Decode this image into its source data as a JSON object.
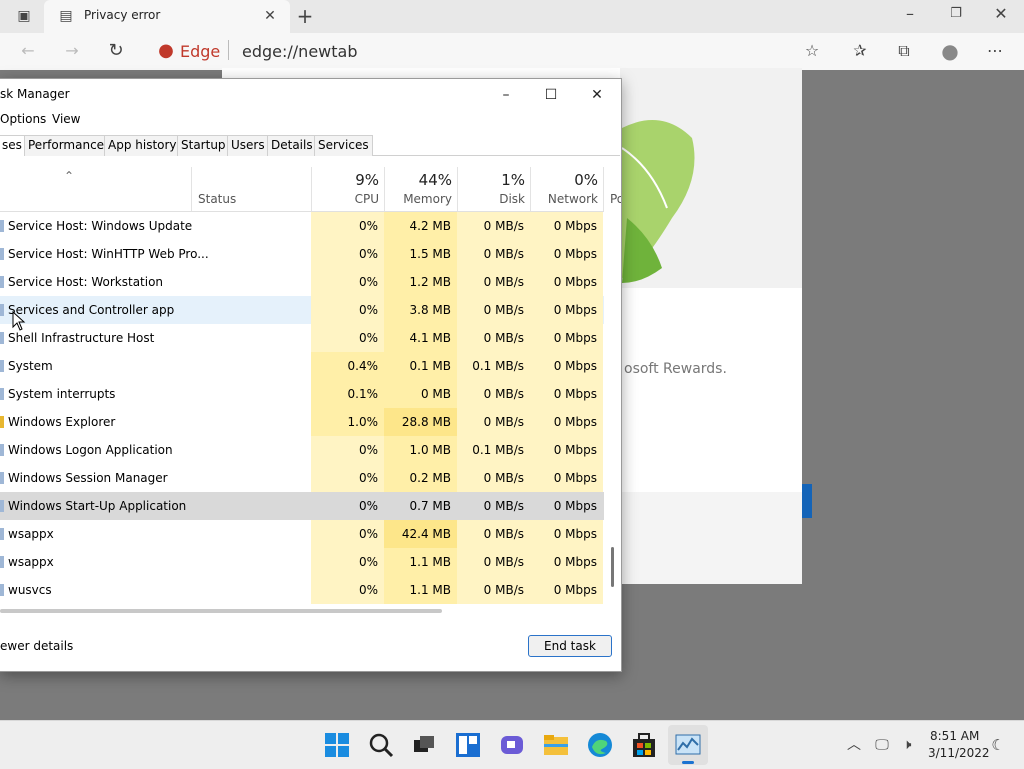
{
  "browser": {
    "tab_title": "Privacy error",
    "brand": "Edge",
    "url": "edge://newtab"
  },
  "page": {
    "rewards_text": "osoft Rewards."
  },
  "task_manager": {
    "title": "sk Manager",
    "menu": [
      "Options",
      "View"
    ],
    "tabs": [
      "ses",
      "Performance",
      "App history",
      "Startup",
      "Users",
      "Details",
      "Services"
    ],
    "columns": {
      "status": "Status",
      "cpu": {
        "pct": "9%",
        "label": "CPU"
      },
      "memory": {
        "pct": "44%",
        "label": "Memory"
      },
      "disk": {
        "pct": "1%",
        "label": "Disk"
      },
      "network": {
        "pct": "0%",
        "label": "Network"
      },
      "power_partial": "Po"
    },
    "rows": [
      {
        "name": "Service Host: Windows Update",
        "cpu": "0%",
        "mem": "4.2 MB",
        "disk": "0 MB/s",
        "net": "0 Mbps"
      },
      {
        "name": "Service Host: WinHTTP Web Pro...",
        "cpu": "0%",
        "mem": "1.5 MB",
        "disk": "0 MB/s",
        "net": "0 Mbps"
      },
      {
        "name": "Service Host: Workstation",
        "cpu": "0%",
        "mem": "1.2 MB",
        "disk": "0 MB/s",
        "net": "0 Mbps"
      },
      {
        "name": "Services and Controller app",
        "cpu": "0%",
        "mem": "3.8 MB",
        "disk": "0 MB/s",
        "net": "0 Mbps"
      },
      {
        "name": "Shell Infrastructure Host",
        "cpu": "0%",
        "mem": "4.1 MB",
        "disk": "0 MB/s",
        "net": "0 Mbps"
      },
      {
        "name": "System",
        "cpu": "0.4%",
        "mem": "0.1 MB",
        "disk": "0.1 MB/s",
        "net": "0 Mbps"
      },
      {
        "name": "System interrupts",
        "cpu": "0.1%",
        "mem": "0 MB",
        "disk": "0 MB/s",
        "net": "0 Mbps"
      },
      {
        "name": "Windows Explorer",
        "cpu": "1.0%",
        "mem": "28.8 MB",
        "disk": "0 MB/s",
        "net": "0 Mbps"
      },
      {
        "name": "Windows Logon Application",
        "cpu": "0%",
        "mem": "1.0 MB",
        "disk": "0.1 MB/s",
        "net": "0 Mbps"
      },
      {
        "name": "Windows Session Manager",
        "cpu": "0%",
        "mem": "0.2 MB",
        "disk": "0 MB/s",
        "net": "0 Mbps"
      },
      {
        "name": "Windows Start-Up Application",
        "cpu": "0%",
        "mem": "0.7 MB",
        "disk": "0 MB/s",
        "net": "0 Mbps"
      },
      {
        "name": "wsappx",
        "cpu": "0%",
        "mem": "42.4 MB",
        "disk": "0 MB/s",
        "net": "0 Mbps"
      },
      {
        "name": "wsappx",
        "cpu": "0%",
        "mem": "1.1 MB",
        "disk": "0 MB/s",
        "net": "0 Mbps"
      },
      {
        "name": "wusvcs",
        "cpu": "0%",
        "mem": "1.1 MB",
        "disk": "0 MB/s",
        "net": "0 Mbps"
      }
    ],
    "fewer_details": "ewer details",
    "end_task": "End task"
  },
  "taskbar": {
    "time": "8:51 AM",
    "date": "3/11/2022"
  },
  "colors": {
    "heat_light": "#fff4c4",
    "heat_mid": "#ffefa8",
    "heat_dark": "#fde68a",
    "accent": "#2b73c9"
  }
}
